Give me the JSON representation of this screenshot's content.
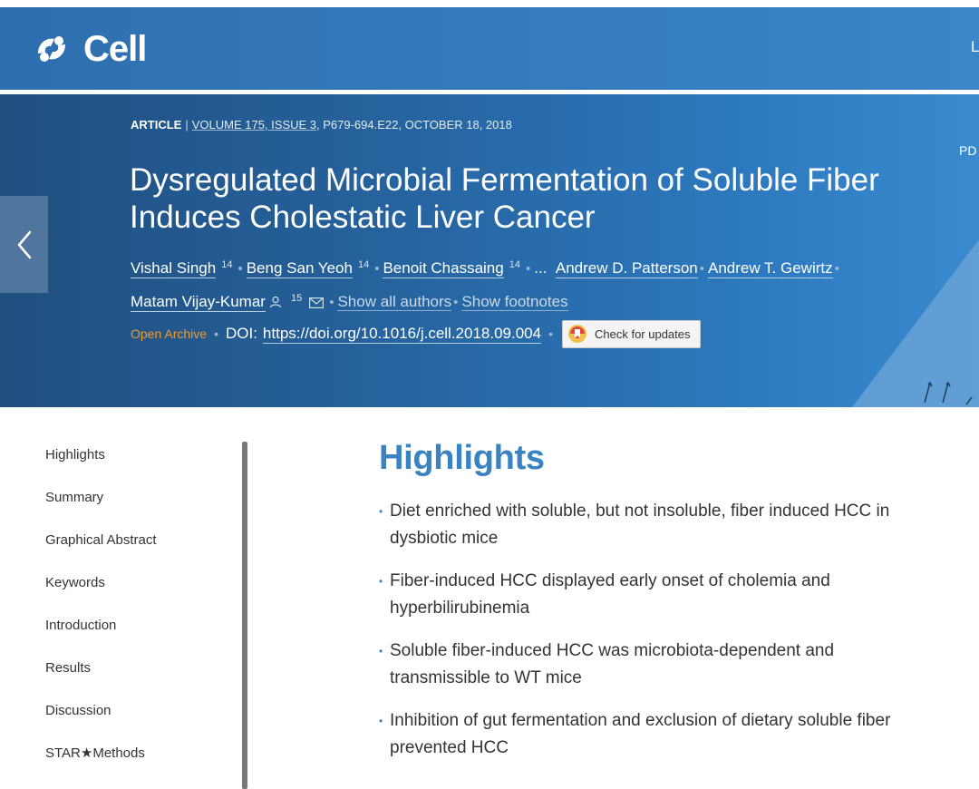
{
  "header": {
    "logo_icon": "cell-logo-icon",
    "logo_text": "Cell",
    "right_edge_text": "L",
    "brand_color": "#3a83c2"
  },
  "hero": {
    "pdf_label": "PD",
    "back_icon": "chevron-left-icon",
    "article_type": "ARTICLE",
    "separator": "|",
    "volume": "VOLUME 175, ISSUE 3",
    "pages_date": ", P679-694.E22, OCTOBER 18, 2018",
    "title_line1": "Dysregulated Microbial Fermentation of Soluble Fiber",
    "title_line2": "Induces Cholestatic Liver Cancer",
    "authors": {
      "a1": "Vishal Singh",
      "a1_sup": "14",
      "a2": "Beng San Yeoh",
      "a2_sup": "14",
      "a3": "Benoit Chassaing",
      "a3_sup": "14",
      "ellipsis": "...",
      "a4": "Andrew D. Patterson",
      "a5": "Andrew T. Gewirtz",
      "a6": "Matam Vijay-Kumar",
      "a6_sup": "15",
      "show_all": "Show all authors",
      "show_footnotes": "Show footnotes"
    },
    "open_archive": "Open Archive",
    "doi_label": "DOI:",
    "doi_url": "https://doi.org/10.1016/j.cell.2018.09.004",
    "check_updates": "Check for updates"
  },
  "sidebar": {
    "items": [
      {
        "label": "Highlights"
      },
      {
        "label": "Summary"
      },
      {
        "label": "Graphical Abstract"
      },
      {
        "label": "Keywords"
      },
      {
        "label": "Introduction"
      },
      {
        "label": "Results"
      },
      {
        "label": "Discussion"
      },
      {
        "label": "STAR★Methods"
      }
    ]
  },
  "main": {
    "heading": "Highlights",
    "highlights": [
      "Diet enriched with soluble, but not insoluble, fiber induced HCC in dysbiotic mice",
      "Fiber-induced HCC displayed early onset of cholemia and hyperbilirubinemia",
      "Soluble fiber-induced HCC was microbiota-dependent and transmissible to WT mice",
      "Inhibition of gut fermentation and exclusion of dietary soluble fiber prevented HCC"
    ]
  }
}
